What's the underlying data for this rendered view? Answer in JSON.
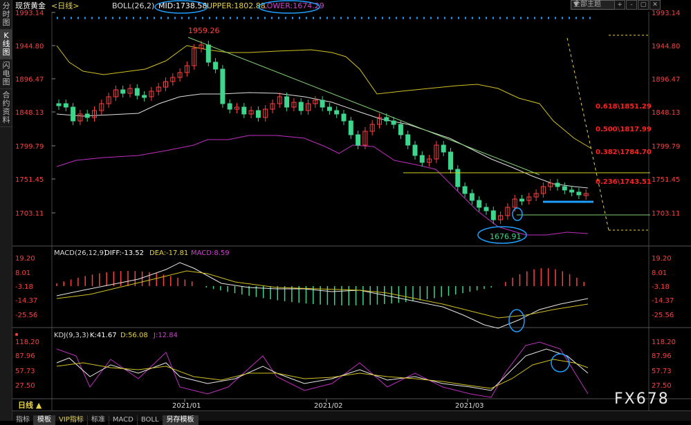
{
  "left_tabs": [
    {
      "label": "分时图",
      "active": false
    },
    {
      "label": "K线图",
      "active": true
    },
    {
      "label": "闪电图",
      "active": false
    },
    {
      "label": "合约资料",
      "active": false
    }
  ],
  "header": {
    "instrument": "现货黄金",
    "period": "<日线>",
    "boll_name": "BOLL(26,2)",
    "mid": "MID:1738.58",
    "upper": "UPPER:1802.88",
    "lower": "LOWER:1674.29",
    "theme_dropdown": "全部主题",
    "buttons": [
      "+",
      "-",
      "▢",
      "✕"
    ]
  },
  "colors": {
    "up": "#ff4040",
    "down": "#3dd68c",
    "mid": "#e0e0e0",
    "upper": "#d4c020",
    "lower": "#c030c0",
    "fib": "#ff2020",
    "annot": "#1ea0ff",
    "trend": "#80d070"
  },
  "price_axis": [
    "1993.14",
    "1944.80",
    "1896.47",
    "1848.13",
    "1799.79",
    "1751.45",
    "1703.11"
  ],
  "price_high_label": "1959.26",
  "price_low_label": "1676.91",
  "fib_levels": [
    "0.618\\1851.29",
    "0.500\\1817.99",
    "0.382\\1784.70",
    "0.236\\1743.51"
  ],
  "macd": {
    "title": "MACD(26,12,9)",
    "diff": "DIFF:-13.52",
    "dea": "DEA:-17.81",
    "macd": "MACD:8.59",
    "axis": [
      "19.20",
      "8.01",
      "-3.18",
      "-14.37",
      "-25.56"
    ]
  },
  "kdj": {
    "title": "KDJ(9,3,3)",
    "k": "K:41.67",
    "d": "D:56.08",
    "j": "J:12.84",
    "axis": [
      "118.20",
      "87.96",
      "57.73",
      "27.50"
    ]
  },
  "dates": [
    "2021/01",
    "2021/02",
    "2021/03"
  ],
  "period_selector": "日线 ▲",
  "bottom_tabs": [
    {
      "label": "指标",
      "active": false
    },
    {
      "label": "模板",
      "active": true
    },
    {
      "label": "VIP指标",
      "active": false
    },
    {
      "label": "标准",
      "active": false
    },
    {
      "label": "MACD",
      "active": false
    },
    {
      "label": "BOLL",
      "active": false
    },
    {
      "label": "另存模板",
      "active": true
    }
  ],
  "watermark": "FX678"
}
